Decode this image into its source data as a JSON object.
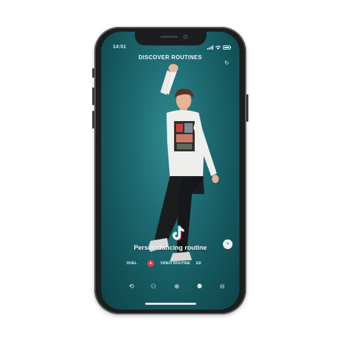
{
  "status_bar": {
    "time": "14:51"
  },
  "header": {
    "title": "DISCOVER ROUTINES",
    "refresh_icon": "refresh-icon"
  },
  "video": {
    "logo_icon": "tiktok-logo-icon",
    "caption": "Person dancing routine",
    "more_icon": "plus-icon"
  },
  "meta": {
    "left_label": "DUEL",
    "live_icon": "record-icon",
    "tag_label": "VIDEO ROUTINE",
    "right_label": "ED"
  },
  "nav": {
    "items": [
      {
        "icon": "rotate-icon"
      },
      {
        "icon": "people-icon"
      },
      {
        "icon": "download-icon"
      },
      {
        "icon": "friends-icon"
      },
      {
        "icon": "menu-icon"
      }
    ]
  },
  "colors": {
    "screen_bg": "#1f6d74",
    "frame": "#1b1d1f",
    "accent_red": "#e63a4c",
    "logo_cyan": "#25f4ee",
    "logo_pink": "#fe2c55"
  }
}
